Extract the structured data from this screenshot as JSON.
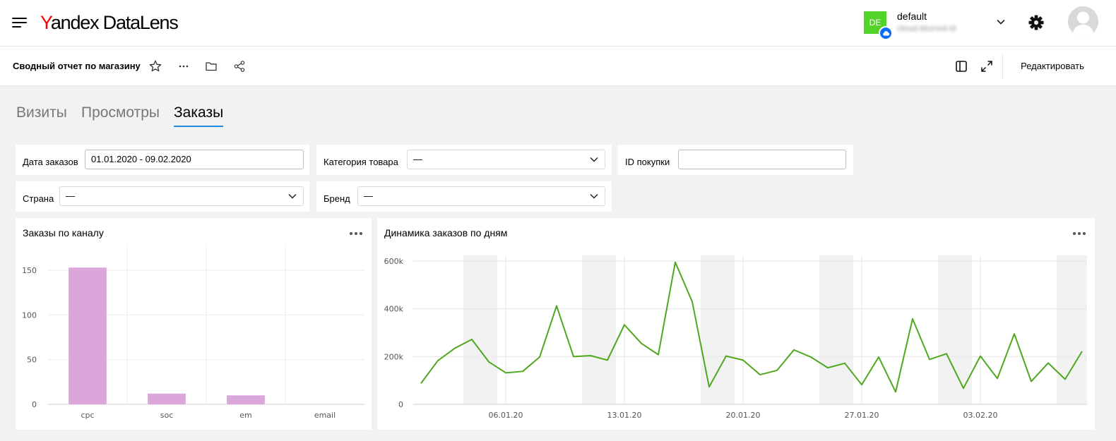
{
  "header": {
    "logo_y": "Y",
    "logo_rest": "andex DataLens",
    "cloud": {
      "badge": "DE",
      "name": "default",
      "subtitle": "cloud-blurred-id"
    },
    "colors": {
      "badge": "#53d22a",
      "cloud_icon": "#0a6cf2"
    }
  },
  "subbar": {
    "title": "Сводный отчет по магазину",
    "icons": [
      "star-icon",
      "more-icon",
      "folder-icon",
      "share-icon",
      "toc-icon",
      "fullscreen-icon"
    ],
    "edit_label": "Редактировать"
  },
  "tabs": [
    {
      "label": "Визиты",
      "active": false
    },
    {
      "label": "Просмотры",
      "active": false
    },
    {
      "label": "Заказы",
      "active": true
    }
  ],
  "filters": {
    "date": {
      "label": "Дата заказов",
      "value": "01.01.2020 - 09.02.2020"
    },
    "category": {
      "label": "Категория товара",
      "value": "—"
    },
    "purchase_id": {
      "label": "ID покупки",
      "value": ""
    },
    "country": {
      "label": "Страна",
      "value": "—"
    },
    "brand": {
      "label": "Бренд",
      "value": "—"
    }
  },
  "widgets": {
    "by_channel": {
      "title": "Заказы по каналу"
    },
    "by_day": {
      "title": "Динамика заказов по дням"
    }
  },
  "chart_data": [
    {
      "type": "bar",
      "categories": [
        "cpc",
        "soc",
        "em",
        "email"
      ],
      "values": [
        153,
        12,
        10,
        0
      ],
      "yticks": [
        "0",
        "50",
        "100",
        "150"
      ],
      "ylim": [
        0,
        165
      ],
      "color": "#dba6d9",
      "grid": true
    },
    {
      "type": "line",
      "x": [
        "01.01.20",
        "02.01.20",
        "03.01.20",
        "04.01.20",
        "05.01.20",
        "06.01.20",
        "07.01.20",
        "08.01.20",
        "09.01.20",
        "10.01.20",
        "11.01.20",
        "12.01.20",
        "13.01.20",
        "14.01.20",
        "15.01.20",
        "16.01.20",
        "17.01.20",
        "18.01.20",
        "19.01.20",
        "20.01.20",
        "21.01.20",
        "22.01.20",
        "23.01.20",
        "24.01.20",
        "25.01.20",
        "26.01.20",
        "27.01.20",
        "28.01.20",
        "29.01.20",
        "30.01.20",
        "31.01.20",
        "01.02.20",
        "02.02.20",
        "03.02.20",
        "04.02.20",
        "05.02.20",
        "06.02.20",
        "07.02.20",
        "08.02.20",
        "09.02.20"
      ],
      "values": [
        88000,
        183000,
        235000,
        272000,
        178000,
        132000,
        138000,
        198000,
        412000,
        200000,
        204000,
        185000,
        333000,
        255000,
        208000,
        595000,
        430000,
        73000,
        202000,
        185000,
        124000,
        142000,
        228000,
        198000,
        153000,
        172000,
        82000,
        198000,
        52000,
        358000,
        188000,
        212000,
        67000,
        202000,
        108000,
        295000,
        96000,
        173000,
        105000,
        222000
      ],
      "xticks": [
        "06.01.20",
        "13.01.20",
        "20.01.20",
        "27.01.20",
        "03.02.20"
      ],
      "yticks": [
        "0",
        "200k",
        "400k",
        "600k"
      ],
      "ylim": [
        0,
        600000
      ],
      "weekend_bands": [
        [
          "04.01.20",
          "05.01.20"
        ],
        [
          "11.01.20",
          "12.01.20"
        ],
        [
          "18.01.20",
          "19.01.20"
        ],
        [
          "25.01.20",
          "26.01.20"
        ],
        [
          "01.02.20",
          "02.02.20"
        ],
        [
          "08.02.20",
          "09.02.20"
        ]
      ],
      "color": "#4fa71e",
      "grid": true
    }
  ]
}
